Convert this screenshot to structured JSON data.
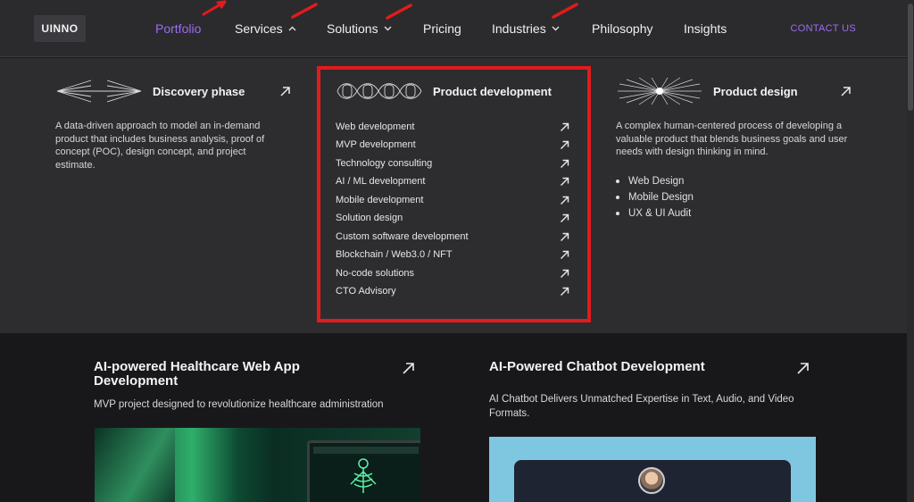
{
  "logo": "UINNO",
  "nav": {
    "items": [
      {
        "label": "Portfolio",
        "active": true,
        "chevron": ""
      },
      {
        "label": "Services",
        "chevron": "up"
      },
      {
        "label": "Solutions",
        "chevron": "down"
      },
      {
        "label": "Pricing",
        "chevron": ""
      },
      {
        "label": "Industries",
        "chevron": "down"
      },
      {
        "label": "Philosophy",
        "chevron": ""
      },
      {
        "label": "Insights",
        "chevron": ""
      }
    ],
    "contact": "CONTACT US"
  },
  "dropdown": {
    "discovery": {
      "title": "Discovery phase",
      "description_lines": [
        "A data-driven approach to model an in-demand",
        "product that includes business analysis, proof of",
        "concept (POC), design concept, and project",
        "estimate."
      ]
    },
    "product_development": {
      "title": "Product development",
      "links": [
        "Web development",
        "MVP development",
        "Technology consulting",
        "AI / ML development",
        "Mobile development",
        "Solution design",
        "Custom software development",
        "Blockchain / Web3.0 / NFT",
        "No-code solutions",
        "CTO Advisory"
      ]
    },
    "product_design": {
      "title": "Product design",
      "description_lines": [
        "A complex human-centered process of developing a",
        "valuable product that blends business goals and user",
        "needs with design thinking in mind."
      ],
      "bullets": [
        "Web Design",
        "Mobile Design",
        "UX & UI Audit"
      ]
    }
  },
  "cards": [
    {
      "title_lines": [
        "AI-powered Healthcare Web App",
        "Development"
      ],
      "description_lines": [
        "MVP project designed to revolutionize healthcare administration"
      ]
    },
    {
      "title_lines": [
        "AI-Powered Chatbot Development"
      ],
      "description_lines": [
        "AI Chatbot Delivers Unmatched Expertise in Text, Audio, and Video",
        "Formats."
      ]
    }
  ],
  "colors": {
    "accent": "#9b6cf5",
    "highlight": "#e21b1b",
    "nav_bg": "#2b2b2e",
    "panel_bg": "#2d2d30",
    "page_bg": "#18181b"
  }
}
